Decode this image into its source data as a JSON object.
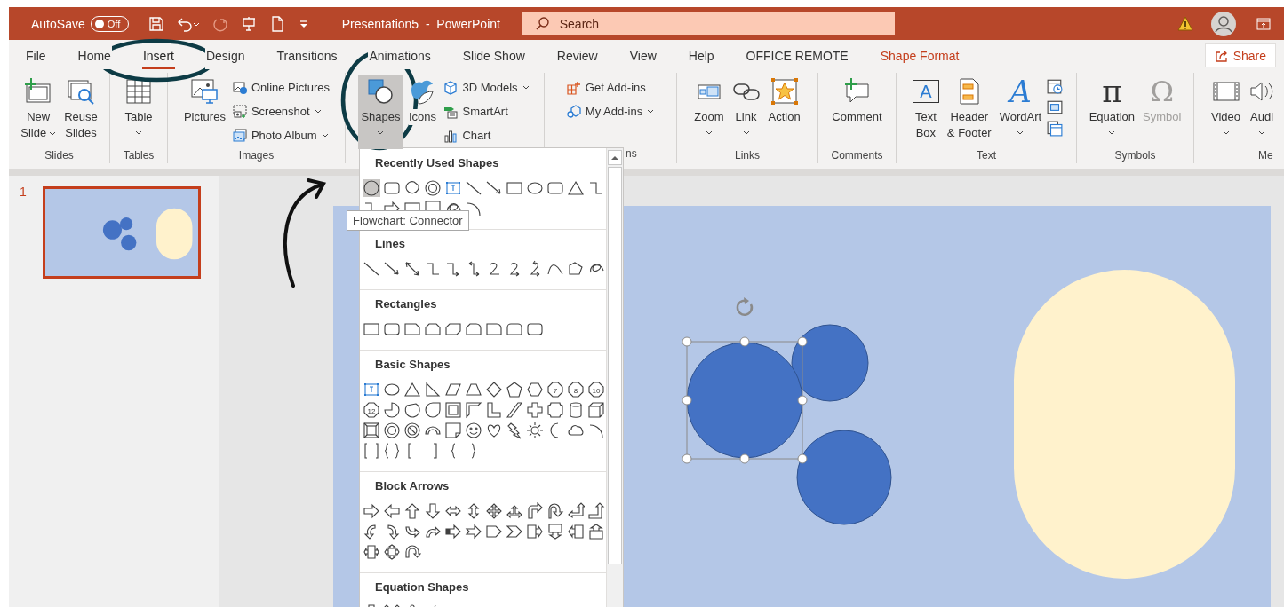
{
  "title_bar": {
    "autosave_label": "AutoSave",
    "autosave": {
      "on": false,
      "state_label": "Off"
    },
    "document_title": "Presentation5  -  PowerPoint",
    "search": {
      "placeholder": "Search"
    }
  },
  "tabs": [
    {
      "label": "File",
      "selected": false,
      "kind": "standard"
    },
    {
      "label": "Home",
      "selected": false,
      "kind": "standard"
    },
    {
      "label": "Insert",
      "selected": true,
      "kind": "standard"
    },
    {
      "label": "Design",
      "selected": false,
      "kind": "standard"
    },
    {
      "label": "Transitions",
      "selected": false,
      "kind": "standard"
    },
    {
      "label": "Animations",
      "selected": false,
      "kind": "standard"
    },
    {
      "label": "Slide Show",
      "selected": false,
      "kind": "standard"
    },
    {
      "label": "Review",
      "selected": false,
      "kind": "standard"
    },
    {
      "label": "View",
      "selected": false,
      "kind": "standard"
    },
    {
      "label": "Help",
      "selected": false,
      "kind": "standard"
    },
    {
      "label": "OFFICE REMOTE",
      "selected": false,
      "kind": "standard"
    },
    {
      "label": "Shape Format",
      "selected": false,
      "kind": "contextual"
    }
  ],
  "share_button": "Share",
  "ribbon_groups": [
    {
      "label": "Slides",
      "items": [
        {
          "kind": "large",
          "label": [
            "New",
            "Slide"
          ],
          "dropdown": true,
          "pressed": false,
          "disabled": false
        },
        {
          "kind": "large",
          "label": [
            "Reuse",
            "Slides"
          ],
          "dropdown": false,
          "pressed": false,
          "disabled": false
        }
      ]
    },
    {
      "label": "Tables",
      "items": [
        {
          "kind": "large",
          "label": [
            "Table"
          ],
          "dropdown": true,
          "pressed": false,
          "disabled": false
        }
      ]
    },
    {
      "label": "Images",
      "items": [
        {
          "kind": "large",
          "label": [
            "Pictures"
          ],
          "dropdown": false,
          "pressed": false,
          "disabled": false
        },
        {
          "kind": "stack",
          "items": [
            {
              "label": "Online Pictures",
              "dropdown": false
            },
            {
              "label": "Screenshot",
              "dropdown": true
            },
            {
              "label": "Photo Album",
              "dropdown": true
            }
          ]
        }
      ]
    },
    {
      "items": [
        {
          "kind": "large",
          "label": [
            "Shapes"
          ],
          "dropdown": true,
          "pressed": true,
          "disabled": false
        },
        {
          "kind": "large",
          "label": [
            "Icons"
          ],
          "dropdown": false,
          "pressed": false,
          "disabled": false
        },
        {
          "kind": "stack",
          "items": [
            {
              "label": "3D Models",
              "dropdown": true
            },
            {
              "label": "SmartArt",
              "dropdown": false
            },
            {
              "label": "Chart",
              "dropdown": false
            }
          ]
        }
      ]
    },
    {
      "label": "ns",
      "items": [
        {
          "kind": "stack",
          "items": [
            {
              "label": "Get Add-ins",
              "dropdown": false
            },
            {
              "label": "My Add-ins",
              "dropdown": true
            }
          ]
        }
      ]
    },
    {
      "label": "Links",
      "items": [
        {
          "kind": "large",
          "label": [
            "Zoom"
          ],
          "dropdown": true,
          "pressed": false,
          "disabled": false
        },
        {
          "kind": "large",
          "label": [
            "Link"
          ],
          "dropdown": true,
          "pressed": false,
          "disabled": false
        },
        {
          "kind": "large",
          "label": [
            "Action"
          ],
          "dropdown": false,
          "pressed": false,
          "disabled": false
        }
      ]
    },
    {
      "label": "Comments",
      "items": [
        {
          "kind": "large",
          "label": [
            "Comment"
          ],
          "dropdown": false,
          "pressed": false,
          "disabled": false
        }
      ]
    },
    {
      "label": "Text",
      "items": [
        {
          "kind": "large",
          "glyph": "A",
          "label": [
            "Text",
            "Box"
          ],
          "dropdown": false,
          "pressed": false,
          "disabled": false
        },
        {
          "kind": "large",
          "label": [
            "Header",
            "& Footer"
          ],
          "dropdown": false,
          "pressed": false,
          "disabled": false
        },
        {
          "kind": "large",
          "glyph": "A",
          "label": [
            "WordArt"
          ],
          "dropdown": true,
          "pressed": false,
          "disabled": false
        },
        {
          "kind": "icon_stack"
        }
      ]
    },
    {
      "label": "Symbols",
      "items": [
        {
          "kind": "large",
          "glyph": "π",
          "label": [
            "Equation"
          ],
          "dropdown": true,
          "pressed": false,
          "disabled": false
        },
        {
          "kind": "large",
          "glyph": "Ω",
          "label": [
            "Symbol"
          ],
          "dropdown": false,
          "pressed": false,
          "disabled": true
        }
      ]
    },
    {
      "label": "Me",
      "items": [
        {
          "kind": "large",
          "label": [
            "Video"
          ],
          "dropdown": true,
          "pressed": false,
          "disabled": false
        },
        {
          "kind": "large",
          "label": [
            "Audi"
          ],
          "dropdown": true,
          "pressed": false,
          "disabled": false
        }
      ]
    }
  ],
  "slides": [
    {
      "number": "1",
      "selected": true
    }
  ],
  "shapes_gallery": {
    "sections": [
      {
        "title": "Recently Used Shapes"
      },
      {
        "title": "Lines"
      },
      {
        "title": "Rectangles"
      },
      {
        "title": "Basic Shapes",
        "shape_labels": [
          "7",
          "8",
          "10",
          "12"
        ]
      },
      {
        "title": "Block Arrows"
      },
      {
        "title": "Equation Shapes"
      }
    ],
    "tooltip": "Flowchart: Connector"
  }
}
